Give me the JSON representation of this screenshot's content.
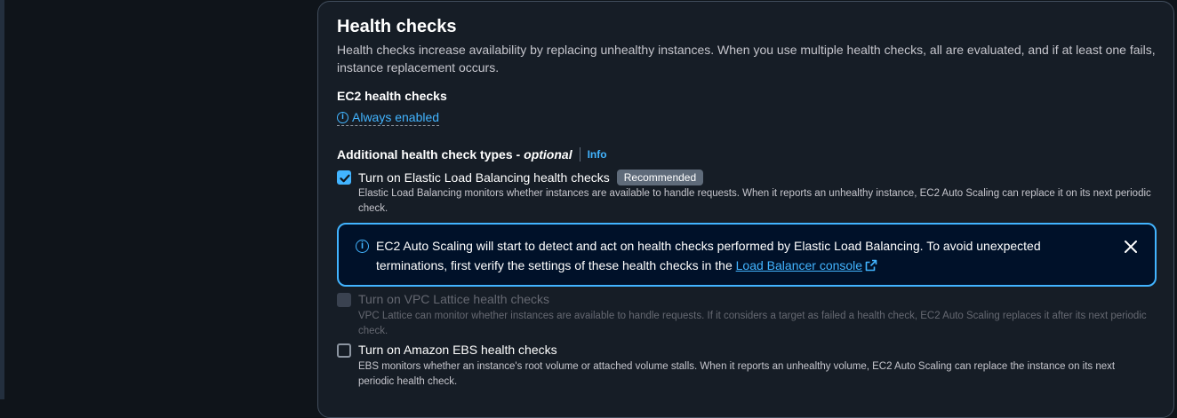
{
  "section": {
    "title": "Health checks",
    "description": "Health checks increase availability by replacing unhealthy instances. When you use multiple health checks, all are evaluated, and if at least one fails, instance replacement occurs."
  },
  "ec2": {
    "label": "EC2 health checks",
    "status": "Always enabled"
  },
  "additional": {
    "label": "Additional health check types - ",
    "optional": "optional",
    "info": "Info"
  },
  "elb": {
    "label": "Turn on Elastic Load Balancing health checks",
    "badge": "Recommended",
    "description": "Elastic Load Balancing monitors whether instances are available to handle requests. When it reports an unhealthy instance, EC2 Auto Scaling can replace it on its next periodic check.",
    "checked": true
  },
  "alert": {
    "text": "EC2 Auto Scaling will start to detect and act on health checks performed by Elastic Load Balancing. To avoid unexpected terminations, first verify the settings of these health checks in the ",
    "link": "Load Balancer console"
  },
  "vpc": {
    "label": "Turn on VPC Lattice health checks",
    "description": "VPC Lattice can monitor whether instances are available to handle requests. If it considers a target as failed a health check, EC2 Auto Scaling replaces it after its next periodic check.",
    "checked": false,
    "disabled": true
  },
  "ebs": {
    "label": "Turn on Amazon EBS health checks",
    "description": "EBS monitors whether an instance's root volume or attached volume stalls. When it reports an unhealthy volume, EC2 Auto Scaling can replace the instance on its next periodic health check.",
    "checked": false
  },
  "colors": {
    "accent": "#42b4ff",
    "panel_bg": "#161d26",
    "page_bg": "#0f141a",
    "alert_bg": "#001129"
  }
}
